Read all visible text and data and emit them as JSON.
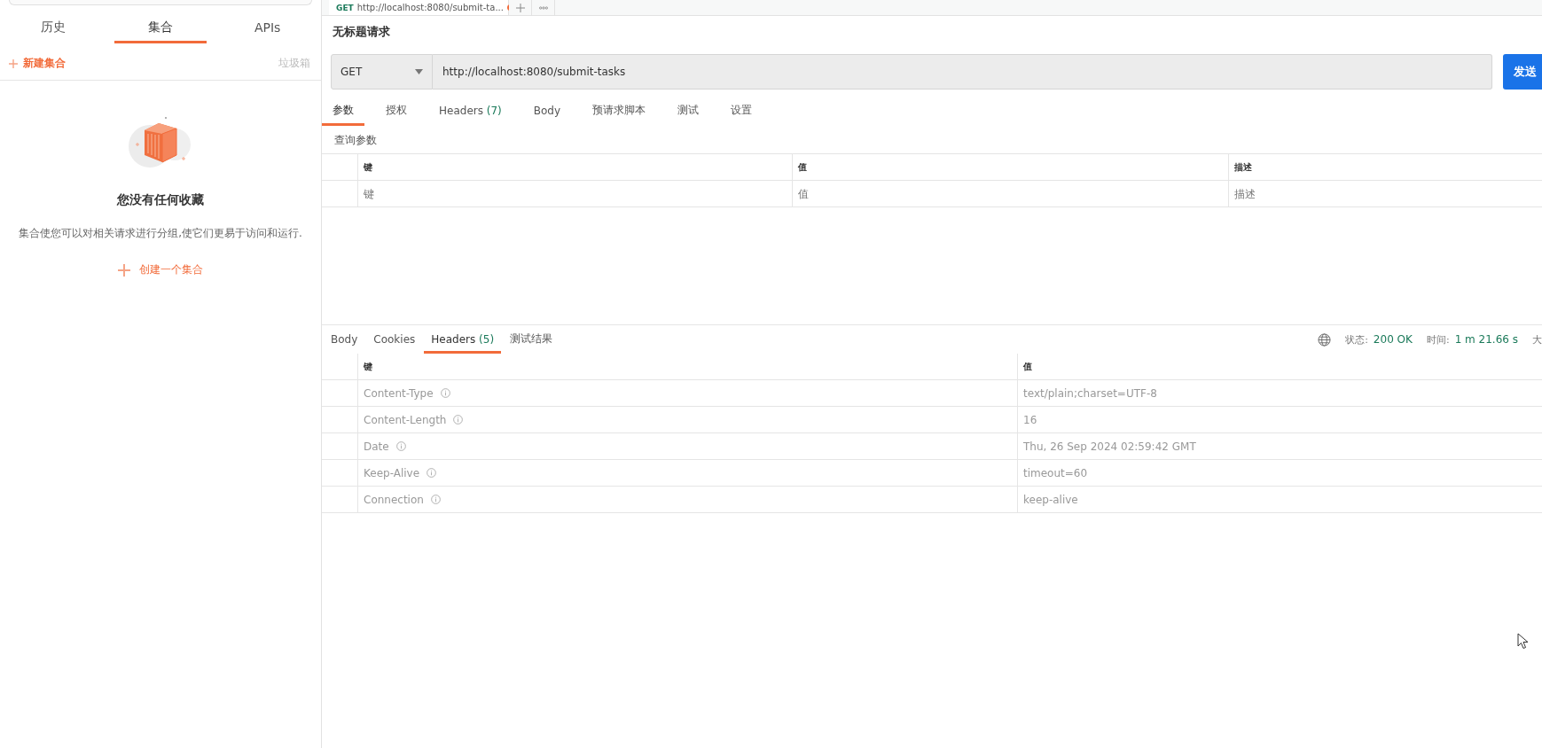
{
  "sidebar": {
    "tabs": [
      {
        "label": "历史",
        "selected": false
      },
      {
        "label": "集合",
        "selected": true
      },
      {
        "label": "APIs",
        "selected": false
      }
    ],
    "new_collection": "新建集合",
    "trash": "垃圾箱",
    "empty_title": "您没有任何收藏",
    "empty_text": "集合使您可以对相关请求进行分组,使它们更易于访问和运行.",
    "create": "创建一个集合"
  },
  "request_tab": {
    "method": "GET",
    "title": "http://localhost:8080/submit-ta...",
    "modified": true
  },
  "request": {
    "title": "无标题请求",
    "method": "GET",
    "url": "http://localhost:8080/submit-tasks",
    "send": "发送",
    "tabs": [
      {
        "label": "参数",
        "selected": true
      },
      {
        "label": "授权",
        "selected": false
      },
      {
        "label": "Headers",
        "count": "(7)",
        "selected": false
      },
      {
        "label": "Body",
        "selected": false
      },
      {
        "label": "预请求脚本",
        "selected": false
      },
      {
        "label": "测试",
        "selected": false
      },
      {
        "label": "设置",
        "selected": false
      }
    ],
    "params_title": "查询参数",
    "params_columns": [
      "键",
      "值",
      "描述"
    ],
    "params_placeholders": [
      "键",
      "值",
      "描述"
    ]
  },
  "response": {
    "tabs": [
      {
        "label": "Body",
        "selected": false
      },
      {
        "label": "Cookies",
        "selected": false
      },
      {
        "label": "Headers",
        "count": "(5)",
        "selected": true
      },
      {
        "label": "测试结果",
        "selected": false
      }
    ],
    "status_label": "状态:",
    "status": "200 OK",
    "time_label": "时间:",
    "time": "1 m 21.66 s",
    "size_label": "大",
    "columns": [
      "键",
      "值"
    ],
    "headers": [
      {
        "key": "Content-Type",
        "value": "text/plain;charset=UTF-8"
      },
      {
        "key": "Content-Length",
        "value": "16"
      },
      {
        "key": "Date",
        "value": "Thu, 26 Sep 2024 02:59:42 GMT"
      },
      {
        "key": "Keep-Alive",
        "value": "timeout=60"
      },
      {
        "key": "Connection",
        "value": "keep-alive"
      }
    ]
  }
}
